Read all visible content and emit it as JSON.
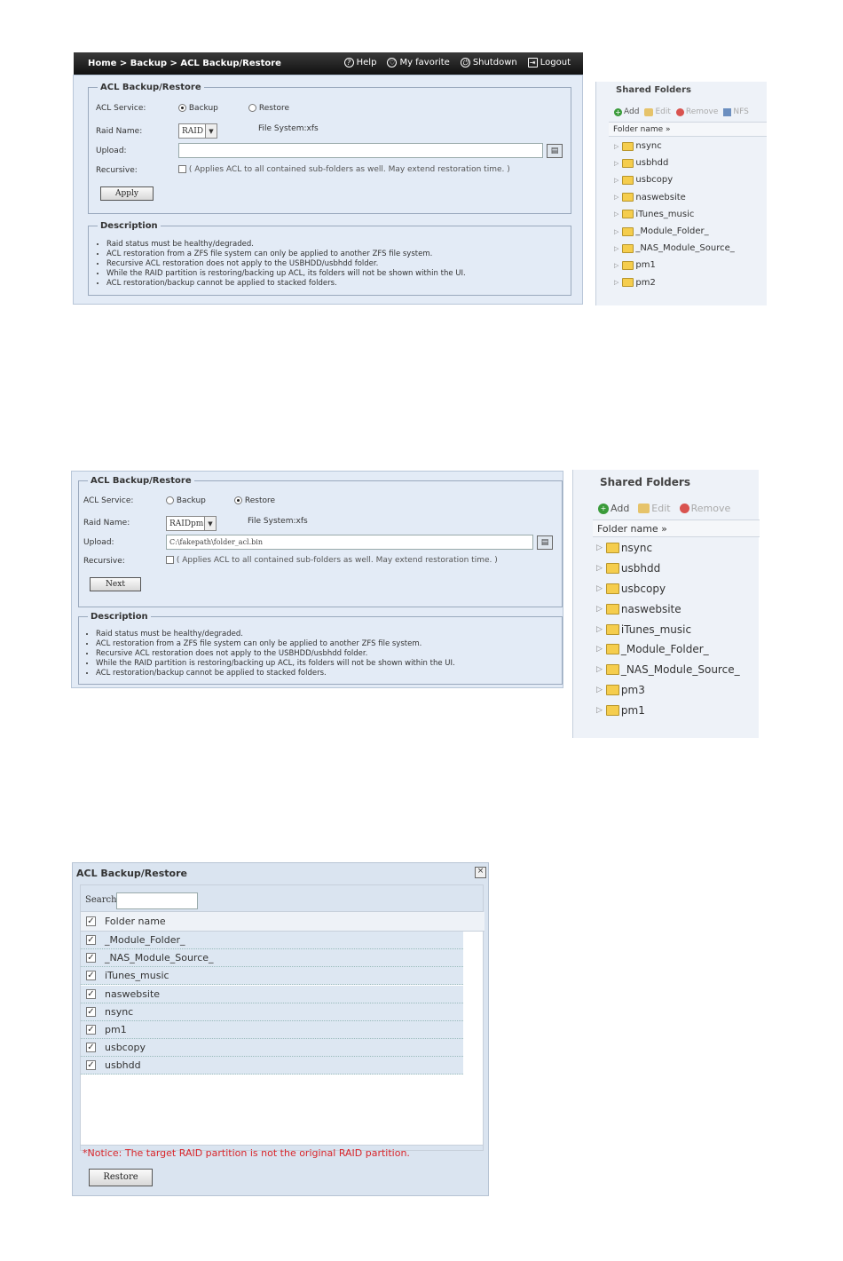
{
  "screen1": {
    "breadcrumb": "Home > Backup > ACL Backup/Restore",
    "top_actions": {
      "help": "Help",
      "favorite": "My favorite",
      "shutdown": "Shutdown",
      "logout": "Logout"
    },
    "legend": "ACL Backup/Restore",
    "service_label": "ACL Service:",
    "backup_label": "Backup",
    "restore_label": "Restore",
    "raid_label": "Raid Name:",
    "raid_value": "RAID",
    "fs_label": "File System:xfs",
    "upload_label": "Upload:",
    "upload_value": "",
    "recursive_label": "Recursive:",
    "recursive_text": "( Applies ACL to all contained sub-folders as well. May extend restoration time. )",
    "apply_button": "Apply",
    "desc_legend": "Description",
    "desc_items": [
      "Raid status must be healthy/degraded.",
      "ACL restoration from a ZFS file system can only be applied to another ZFS file system.",
      "Recursive ACL restoration does not apply to the USBHDD/usbhdd folder.",
      "While the RAID partition is restoring/backing up ACL, its folders will not be shown within the UI.",
      "ACL restoration/backup cannot be applied to stacked folders."
    ]
  },
  "shared1": {
    "title": "Shared Folders",
    "add": "Add",
    "edit": "Edit",
    "remove": "Remove",
    "nfs": "NFS",
    "folder_name_header": "Folder name »",
    "folders": [
      "nsync",
      "usbhdd",
      "usbcopy",
      "naswebsite",
      "iTunes_music",
      "_Module_Folder_",
      "_NAS_Module_Source_",
      "pm1",
      "pm2"
    ]
  },
  "screen2": {
    "legend": "ACL Backup/Restore",
    "service_label": "ACL Service:",
    "backup_label": "Backup",
    "restore_label": "Restore",
    "raid_label": "Raid Name:",
    "raid_value": "RAIDpm",
    "fs_label": "File System:xfs",
    "upload_label": "Upload:",
    "upload_value": "C:\\fakepath\\folder_acl.bin",
    "recursive_label": "Recursive:",
    "recursive_text": "( Applies ACL to all contained sub-folders as well. May extend restoration time. )",
    "next_button": "Next",
    "desc_legend": "Description",
    "desc_items": [
      "Raid status must be healthy/degraded.",
      "ACL restoration from a ZFS file system can only be applied to another ZFS file system.",
      "Recursive ACL restoration does not apply to the USBHDD/usbhdd folder.",
      "While the RAID partition is restoring/backing up ACL, its folders will not be shown within the UI.",
      "ACL restoration/backup cannot be applied to stacked folders."
    ]
  },
  "shared2": {
    "title": "Shared Folders",
    "add": "Add",
    "edit": "Edit",
    "remove": "Remove",
    "folder_name_header": "Folder name »",
    "folders": [
      "nsync",
      "usbhdd",
      "usbcopy",
      "naswebsite",
      "iTunes_music",
      "_Module_Folder_",
      "_NAS_Module_Source_",
      "pm3",
      "pm1"
    ]
  },
  "dialog": {
    "title": "ACL Backup/Restore",
    "close": "×",
    "search_label": "Search:",
    "search_value": "",
    "column_header": "Folder name",
    "rows": [
      "_Module_Folder_",
      "_NAS_Module_Source_",
      "iTunes_music",
      "naswebsite",
      "nsync",
      "pm1",
      "usbcopy",
      "usbhdd"
    ],
    "notice": "*Notice: The target RAID partition is not the original RAID partition.",
    "restore_button": "Restore"
  }
}
